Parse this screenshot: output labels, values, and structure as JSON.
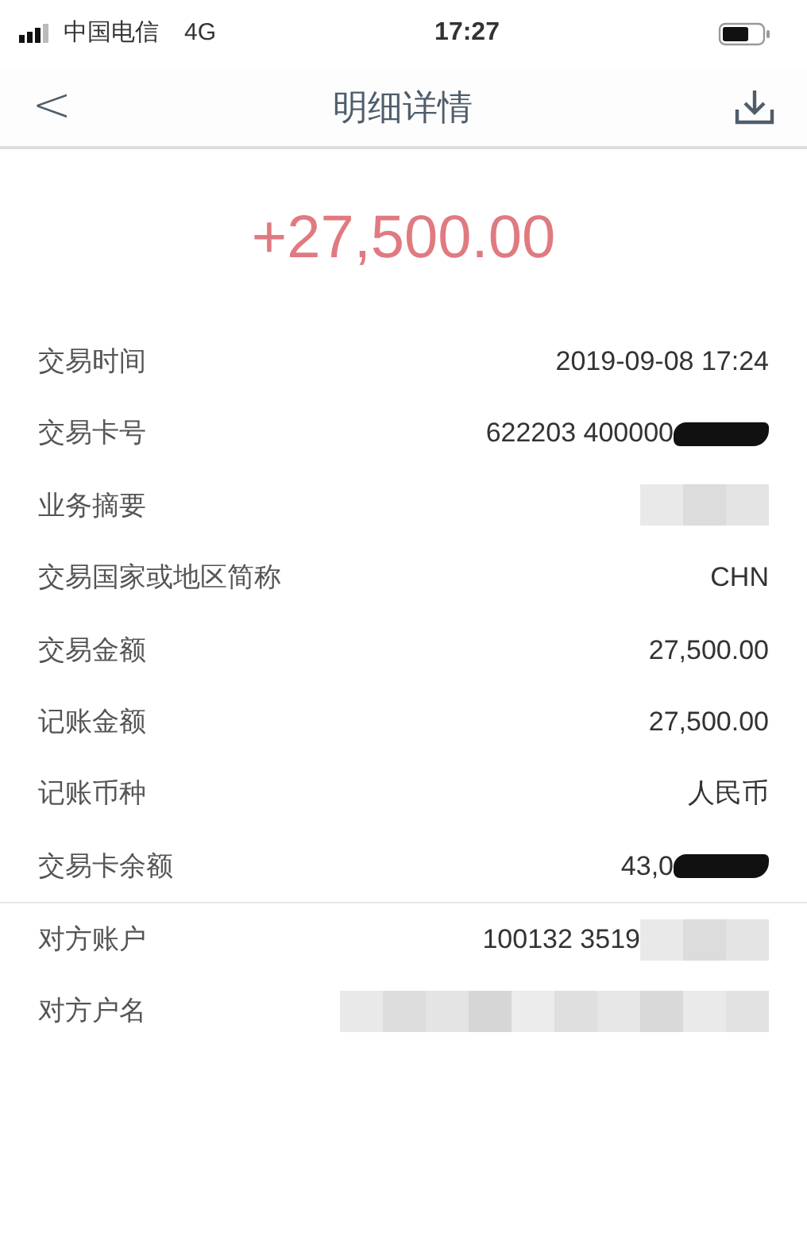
{
  "status_bar": {
    "carrier": "中国电信",
    "network": "4G",
    "time": "17:27"
  },
  "nav": {
    "back": "<",
    "title": "明细详情"
  },
  "amount": "+27,500.00",
  "sections": [
    {
      "rows": [
        {
          "kind": "plain",
          "label": "交易时间",
          "value": "2019-09-08 17:24"
        },
        {
          "kind": "inked",
          "label": "交易卡号",
          "value": "622203 400000"
        },
        {
          "kind": "blurred",
          "label": "业务摘要"
        },
        {
          "kind": "plain",
          "label": "交易国家或地区简称",
          "value": "CHN"
        },
        {
          "kind": "plain",
          "label": "交易金额",
          "value": "27,500.00"
        },
        {
          "kind": "plain",
          "label": "记账金额",
          "value": "27,500.00"
        },
        {
          "kind": "plain",
          "label": "记账币种",
          "value": "人民币"
        },
        {
          "kind": "inked",
          "label": "交易卡余额",
          "value": "43,0"
        }
      ]
    },
    {
      "rows": [
        {
          "kind": "blurred",
          "label": "对方账户",
          "value": "100132 3519"
        },
        {
          "kind": "masked",
          "label": "对方户名"
        }
      ]
    }
  ]
}
